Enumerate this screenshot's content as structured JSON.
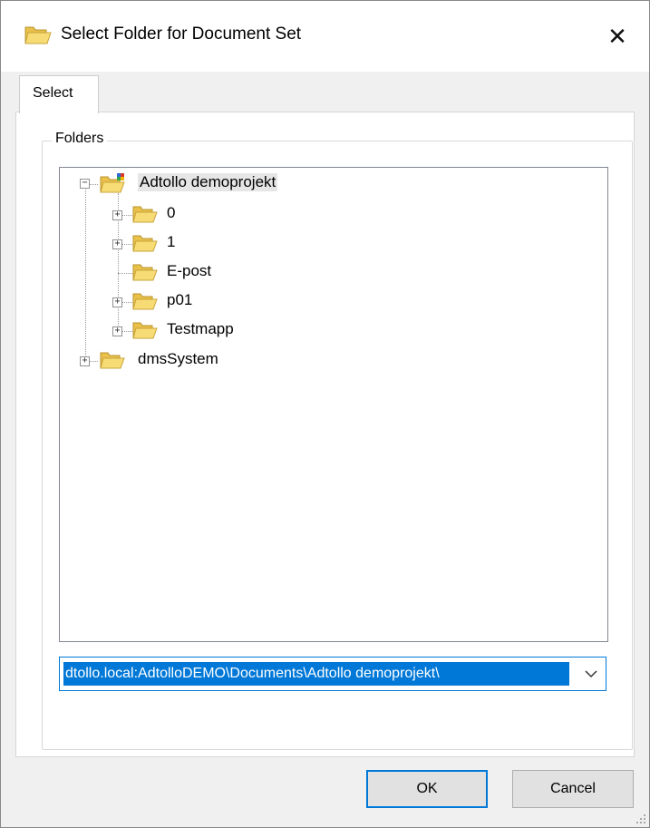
{
  "dialog": {
    "title": "Select Folder for Document Set",
    "close_icon": "close-icon",
    "title_icon": "folder-icon"
  },
  "tabs": [
    {
      "label": "Select",
      "active": true
    }
  ],
  "folders_group": {
    "label": "Folders"
  },
  "tree": {
    "root": {
      "label": "Adtollo demoprojekt",
      "expanded": true,
      "selected": true,
      "icon": "project-folder-icon"
    },
    "children": [
      {
        "label": "0",
        "expandable": true
      },
      {
        "label": "1",
        "expandable": true
      },
      {
        "label": "E-post",
        "expandable": false
      },
      {
        "label": "p01",
        "expandable": true
      },
      {
        "label": "Testmapp",
        "expandable": true
      }
    ],
    "second_root": {
      "label": "dmsSystem",
      "expandable": true
    }
  },
  "path_combo": {
    "value": "dtollo.local:AdtolloDEMO\\Documents\\Adtollo demoprojekt\\"
  },
  "buttons": {
    "ok": "OK",
    "cancel": "Cancel"
  },
  "colors": {
    "accent": "#0078d7",
    "folder_yellow": "#f3d35b",
    "dialog_bg": "#f0f0f0"
  }
}
